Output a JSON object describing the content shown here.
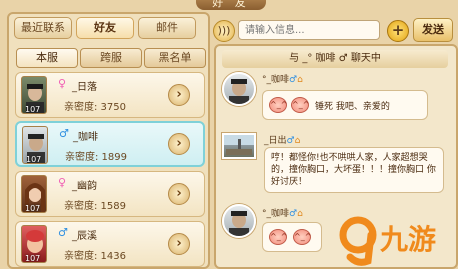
{
  "window": {
    "title": "好 友"
  },
  "top_tabs": [
    {
      "label": "最近联系"
    },
    {
      "label": "好友"
    },
    {
      "label": "邮件"
    }
  ],
  "sub_tabs": [
    {
      "label": "本服"
    },
    {
      "label": "跨服"
    },
    {
      "label": "黑名单"
    }
  ],
  "friends": [
    {
      "gender_symbol": "♀",
      "name": "_日落",
      "intimacy": "亲密度: 3750",
      "level": "107"
    },
    {
      "gender_symbol": "♂",
      "name": "_咖啡",
      "intimacy": "亲密度: 1899",
      "level": "107"
    },
    {
      "gender_symbol": "♀",
      "name": "_幽韵",
      "intimacy": "亲密度: 1589",
      "level": "107"
    },
    {
      "gender_symbol": "♂",
      "name": "_辰溪",
      "intimacy": "亲密度: 1436",
      "level": "107"
    }
  ],
  "composer": {
    "placeholder": "请输入信息...",
    "send_label": "发送"
  },
  "chat": {
    "header": "与 _° 咖啡 ♂ 聊天中",
    "messages": [
      {
        "sender": "°_咖啡",
        "gender_symbol": "♂",
        "emoji1": "^_^",
        "emoji2": "^_^",
        "text": "锤死 我吧、亲爱的"
      },
      {
        "sender": "_日出",
        "gender_symbol": "♂",
        "text": "哼！都怪你!也不哄哄人家，人家超想哭的，撞你胸口，大坏蛋！！！撞你胸口 你好讨厌！"
      },
      {
        "sender": "°_咖啡",
        "gender_symbol": "♂",
        "emoji1": "^_^",
        "emoji2": "^_^"
      }
    ]
  },
  "watermark": {
    "text": "九游"
  },
  "colors": {
    "accent": "#e3a413",
    "panel": "#f0e0bd",
    "selected": "#cfeff2"
  }
}
